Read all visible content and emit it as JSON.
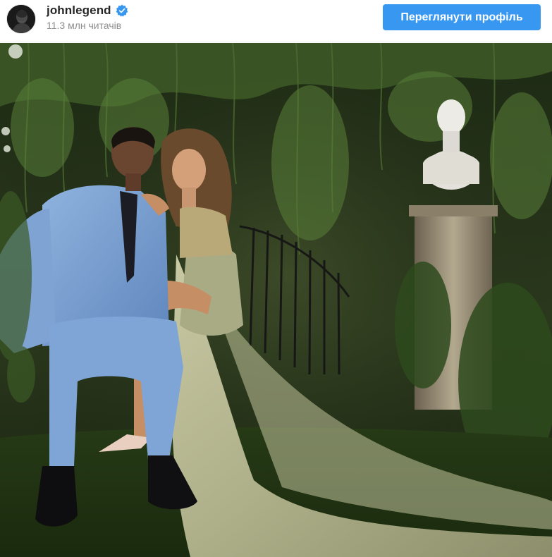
{
  "post_header": {
    "username": "johnlegend",
    "verified": true,
    "followers_text": "11.3 млн читачів",
    "view_profile_label": "Переглянути профіль"
  },
  "icons": {
    "avatar": "profile-photo",
    "verified": "verified-badge-icon"
  },
  "colors": {
    "button_bg": "#3897f0",
    "button_text": "#ffffff",
    "username": "#262626",
    "muted": "#8e8e8e",
    "verified_badge": "#3897f0"
  }
}
